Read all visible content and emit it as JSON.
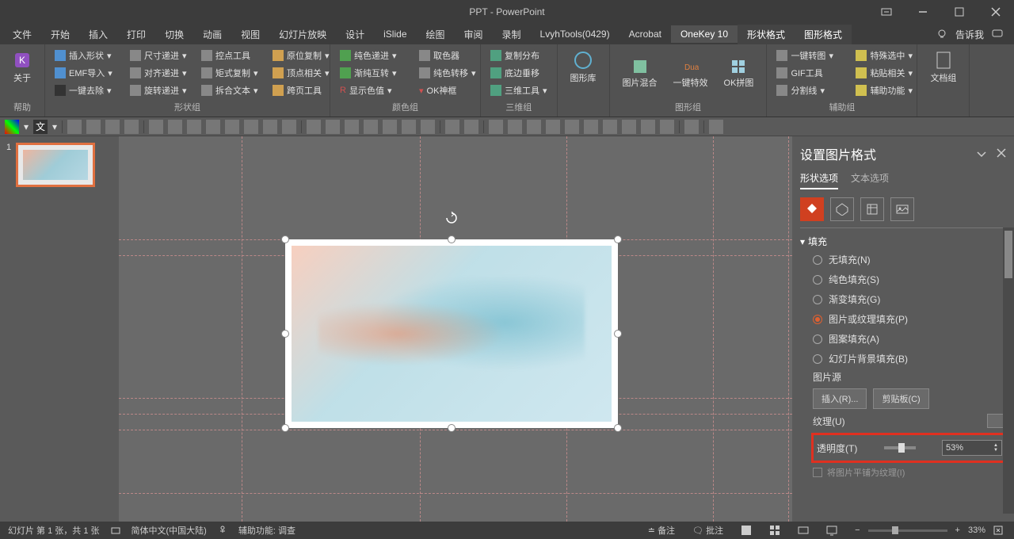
{
  "title": "PPT - PowerPoint",
  "menutabs": [
    "文件",
    "开始",
    "插入",
    "打印",
    "切换",
    "动画",
    "视图",
    "幻灯片放映",
    "设计",
    "iSlide",
    "绘图",
    "审阅",
    "录制",
    "LvyhTools(0429)",
    "Acrobat"
  ],
  "menutabs_right": [
    "OneKey 10",
    "形状格式",
    "图形格式"
  ],
  "tellme": "告诉我",
  "ribbon": {
    "help": {
      "label": "帮助",
      "btn": "关于"
    },
    "shape": {
      "label": "形状组",
      "items": [
        [
          "插入形状",
          "尺寸递进",
          "控点工具",
          "原位复制"
        ],
        [
          "EMF导入",
          "对齐递进",
          "矩式复制",
          "顶点相关"
        ],
        [
          "一键去除",
          "旋转递进",
          "拆合文本",
          "跨页工具"
        ]
      ]
    },
    "color": {
      "label": "颜色组",
      "items": [
        [
          "纯色递进",
          "取色器"
        ],
        [
          "渐纯互转",
          "纯色转移"
        ],
        [
          "显示色值",
          "OK神框"
        ]
      ]
    },
    "threed": {
      "label": "三维组",
      "items": [
        "复制分布",
        "底边垂移",
        "三维工具"
      ]
    },
    "shapelib": {
      "label": "",
      "btn": "图形库"
    },
    "imggroup": {
      "label": "图形组",
      "btns": [
        "图片混合",
        "一键特效",
        "OK拼图"
      ]
    },
    "aux": {
      "label": "辅助组",
      "items": [
        [
          "一键转图",
          "特殊选中"
        ],
        [
          "GIF工具",
          "粘贴相关"
        ],
        [
          "分割线",
          "辅助功能"
        ]
      ]
    },
    "docgroup": {
      "label": "",
      "btn": "文档组"
    }
  },
  "thumb_num": "1",
  "sidepanel": {
    "title": "设置图片格式",
    "tabs": [
      "形状选项",
      "文本选项"
    ],
    "section_fill": "填充",
    "radios": [
      {
        "label": "无填充(N)",
        "sel": false
      },
      {
        "label": "纯色填充(S)",
        "sel": false
      },
      {
        "label": "渐变填充(G)",
        "sel": false
      },
      {
        "label": "图片或纹理填充(P)",
        "sel": true
      },
      {
        "label": "图案填充(A)",
        "sel": false
      },
      {
        "label": "幻灯片背景填充(B)",
        "sel": false
      }
    ],
    "picsource": "图片源",
    "insert_btn": "插入(R)...",
    "clipboard_btn": "剪贴板(C)",
    "texture": "纹理(U)",
    "transparency": "透明度(T)",
    "transparency_val": "53%",
    "tile": "将图片平铺为纹理(I)"
  },
  "statusbar": {
    "slide": "幻灯片 第 1 张，共 1 张",
    "lang": "简体中文(中国大陆)",
    "access": "辅助功能: 调查",
    "notes": "备注",
    "comments": "批注",
    "zoom": "33%"
  }
}
